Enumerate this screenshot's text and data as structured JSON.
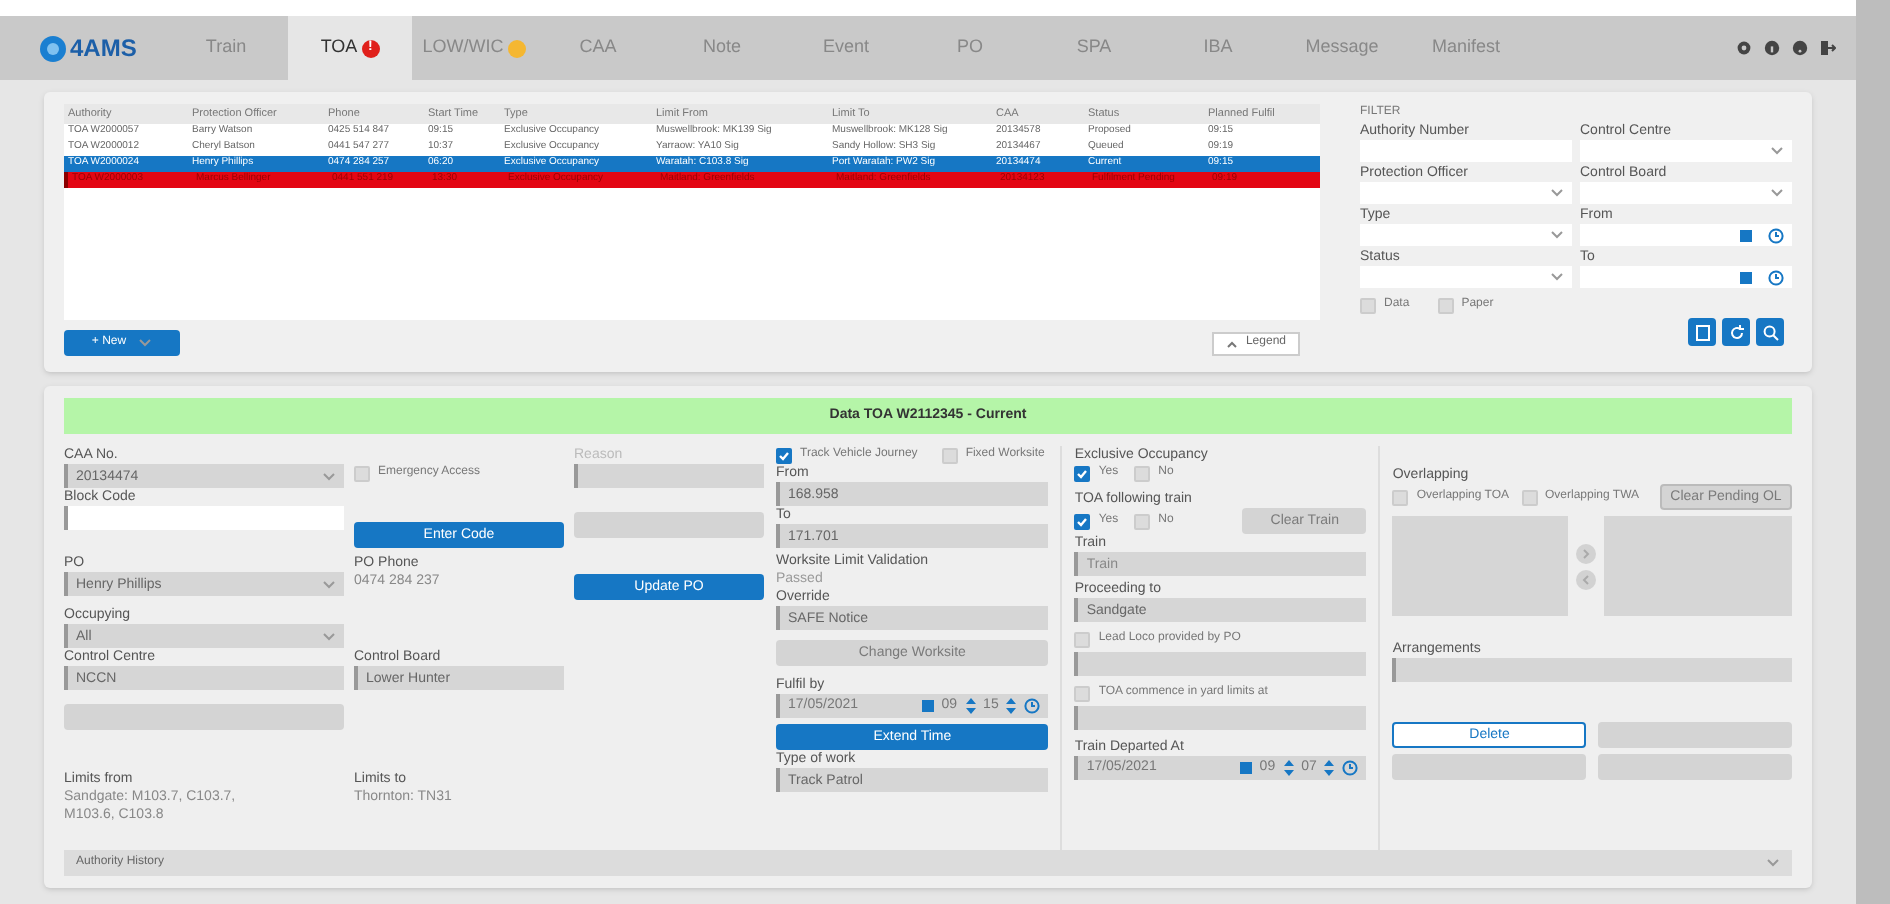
{
  "brand": "4AMS",
  "tabs": [
    {
      "label": "Train",
      "selected": false
    },
    {
      "label": "TOA",
      "selected": true,
      "badge": {
        "kind": "alert",
        "text": "!"
      }
    },
    {
      "label": "LOW/WIC",
      "selected": false,
      "badge": {
        "kind": "warning"
      }
    },
    {
      "label": "CAA",
      "selected": false
    },
    {
      "label": "Note",
      "selected": false
    },
    {
      "label": "Event",
      "selected": false
    },
    {
      "label": "PO",
      "selected": false
    },
    {
      "label": "SPA",
      "selected": false
    },
    {
      "label": "IBA",
      "selected": false
    },
    {
      "label": "Message",
      "selected": false
    },
    {
      "label": "Manifest",
      "selected": false
    }
  ],
  "table": {
    "columns": [
      "Authority",
      "Protection Officer",
      "Phone",
      "Start Time",
      "Type",
      "Limit From",
      "Limit To",
      "CAA",
      "Status",
      "Planned Fulfil"
    ],
    "rows": [
      {
        "selected": false,
        "alert": false,
        "cells": [
          "TOA W2000057",
          "Barry Watson",
          "0425 514 847",
          "09:15",
          "Exclusive Occupancy",
          "Muswellbrook: MK139 Sig",
          "Muswellbrook: MK128 Sig",
          "20134578",
          "Proposed",
          "09:15"
        ]
      },
      {
        "selected": false,
        "alert": false,
        "cells": [
          "TOA W2000012",
          "Cheryl Batson",
          "0441 547 277",
          "10:37",
          "Exclusive Occupancy",
          "Yarraow: YA10 Sig",
          "Sandy Hollow: SH3 Sig",
          "20134467",
          "Queued",
          "09:19"
        ]
      },
      {
        "selected": true,
        "alert": false,
        "cells": [
          "TOA W2000024",
          "Henry Phillips",
          "0474 284 257",
          "06:20",
          "Exclusive Occupancy",
          "Waratah: C103.8 Sig",
          "Port Waratah: PW2 Sig",
          "20134474",
          "Current",
          "09:15"
        ]
      },
      {
        "selected": false,
        "alert": true,
        "cells": [
          "TOA W2000003",
          "Marcus Bellinger",
          "0441 551 219",
          "13:30",
          "Exclusive Occupancy",
          "Maitland: Greenfields",
          "Maitland: Greenfields",
          "20134123",
          "Fulfilment Pending",
          "09:19"
        ]
      }
    ]
  },
  "new_button": "+ New",
  "legend_button": "Legend",
  "filter": {
    "title": "FILTER",
    "fields": [
      {
        "label": "Authority Number",
        "kind": "text"
      },
      {
        "label": "Control Centre",
        "kind": "select"
      },
      {
        "label": "Protection Officer",
        "kind": "select"
      },
      {
        "label": "Control Board",
        "kind": "select"
      },
      {
        "label": "Type",
        "kind": "select"
      },
      {
        "label": "From",
        "kind": "datetime"
      },
      {
        "label": "Status",
        "kind": "select"
      },
      {
        "label": "To",
        "kind": "datetime"
      }
    ],
    "checkboxes": [
      {
        "label": "Data",
        "checked": false
      },
      {
        "label": "Paper",
        "checked": false
      }
    ]
  },
  "detail": {
    "title": "Data TOA W2112345 - Current",
    "caa_no": {
      "label": "CAA No.",
      "value": "20134474"
    },
    "emergency_access": {
      "label": "Emergency Access",
      "checked": false
    },
    "reason": {
      "label": "Reason"
    },
    "block_code": {
      "label": "Block Code"
    },
    "enter_code": "Enter Code",
    "po": {
      "label": "PO",
      "value": "Henry Phillips"
    },
    "po_phone": {
      "label": "PO Phone",
      "value": "0474 284 237"
    },
    "update_po": "Update PO",
    "occupying": {
      "label": "Occupying",
      "value": "All"
    },
    "control_centre": {
      "label": "Control Centre",
      "value": "NCCN"
    },
    "control_board": {
      "label": "Control Board",
      "value": "Lower Hunter"
    },
    "limits_from": {
      "label": "Limits from",
      "value": "Sandgate: M103.7, C103.7, M103.6, C103.8"
    },
    "limits_to": {
      "label": "Limits to",
      "value": "Thornton: TN31"
    },
    "track_vehicle": {
      "label": "Track Vehicle Journey",
      "checked": true
    },
    "fixed_worksite": {
      "label": "Fixed Worksite",
      "checked": false
    },
    "from": {
      "label": "From",
      "value": "168.958"
    },
    "to": {
      "label": "To",
      "value": "171.701"
    },
    "validation": {
      "label": "Worksite Limit Validation",
      "value": "Passed"
    },
    "override": {
      "label": "Override",
      "value": "SAFE Notice"
    },
    "change_worksite": "Change Worksite",
    "fulfil_by": {
      "label": "Fulfil by",
      "date": "17/05/2021",
      "hour": "09",
      "minute": "15"
    },
    "extend_time": "Extend Time",
    "type_of_work": {
      "label": "Type of work",
      "value": "Track Patrol"
    },
    "exclusive": {
      "label": "Exclusive Occupancy",
      "options": [
        {
          "label": "Yes",
          "checked": true
        },
        {
          "label": "No",
          "checked": false
        }
      ]
    },
    "following": {
      "label": "TOA following train",
      "options": [
        {
          "label": "Yes",
          "checked": true
        },
        {
          "label": "No",
          "checked": false
        }
      ]
    },
    "clear_train": "Clear Train",
    "train": {
      "label": "Train",
      "placeholder": "Train"
    },
    "proceeding": {
      "label": "Proceeding to",
      "value": "Sandgate"
    },
    "lead_loco": {
      "label": "Lead Loco provided by PO",
      "checked": false
    },
    "yard_limits": {
      "label": "TOA commence in yard limits at",
      "checked": false
    },
    "departed": {
      "label": "Train Departed At",
      "date": "17/05/2021",
      "hour": "09",
      "minute": "07"
    },
    "overlapping": {
      "label": "Overlapping",
      "options": [
        {
          "label": "Overlapping TOA",
          "checked": false
        },
        {
          "label": "Overlapping TWA",
          "checked": false
        }
      ]
    },
    "clear_pending": "Clear Pending OL",
    "arrangements": {
      "label": "Arrangements"
    },
    "delete": "Delete"
  },
  "history": "Authority History"
}
